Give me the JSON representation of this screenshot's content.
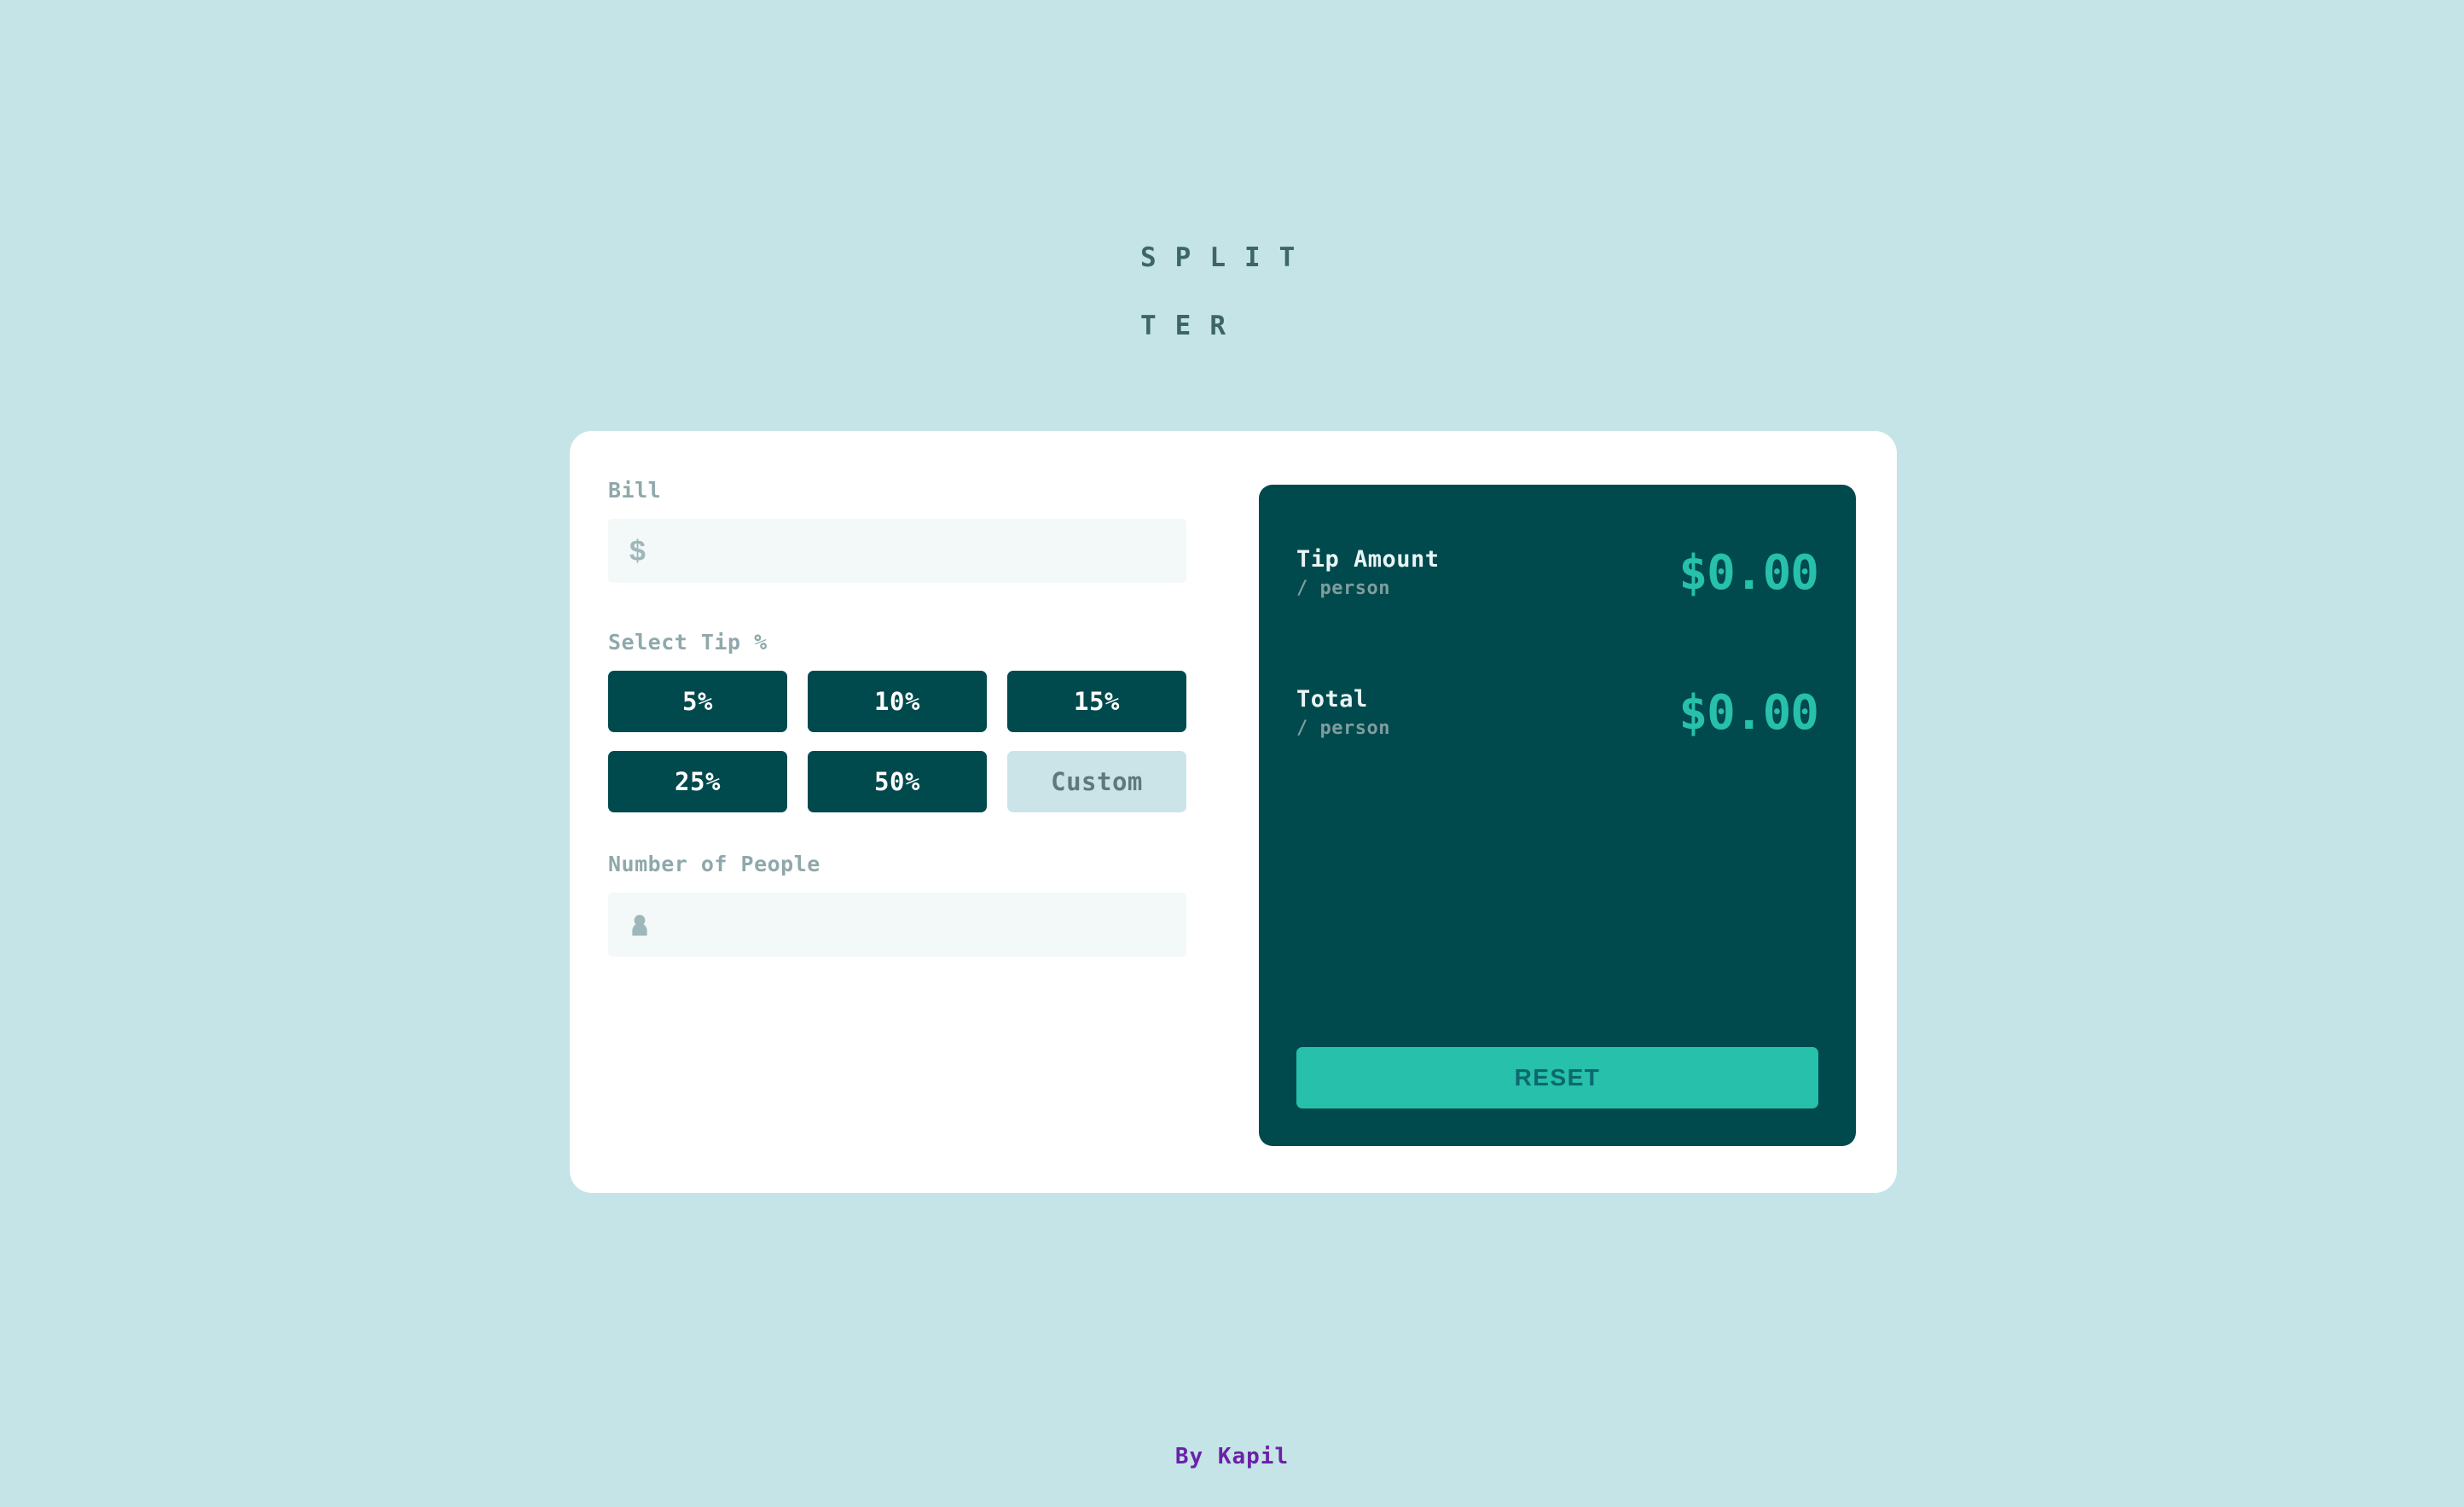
{
  "app": {
    "logo_text": "SPLITTER",
    "background_color": "#C5E4E7",
    "card_color": "#FFFFFF",
    "panel_color": "#00494D",
    "accent_color": "#26C0AB"
  },
  "form": {
    "bill": {
      "label": "Bill",
      "icon": "dollar-icon",
      "icon_glyph": "$",
      "value": "",
      "placeholder": ""
    },
    "tip": {
      "label": "Select Tip %",
      "options": [
        {
          "label": "5%",
          "selected": false
        },
        {
          "label": "10%",
          "selected": false
        },
        {
          "label": "15%",
          "selected": false
        },
        {
          "label": "25%",
          "selected": false
        },
        {
          "label": "50%",
          "selected": false
        }
      ],
      "custom": {
        "label": "Custom",
        "value": "",
        "placeholder": "Custom"
      }
    },
    "people": {
      "label": "Number of People",
      "icon": "person-icon",
      "value": "",
      "placeholder": ""
    }
  },
  "results": {
    "tip_amount": {
      "title": "Tip Amount",
      "sub": "/ person",
      "amount": "$0.00"
    },
    "total": {
      "title": "Total",
      "sub": "/ person",
      "amount": "$0.00"
    },
    "reset_label": "RESET"
  },
  "footer": {
    "credit": "By Kapil"
  }
}
